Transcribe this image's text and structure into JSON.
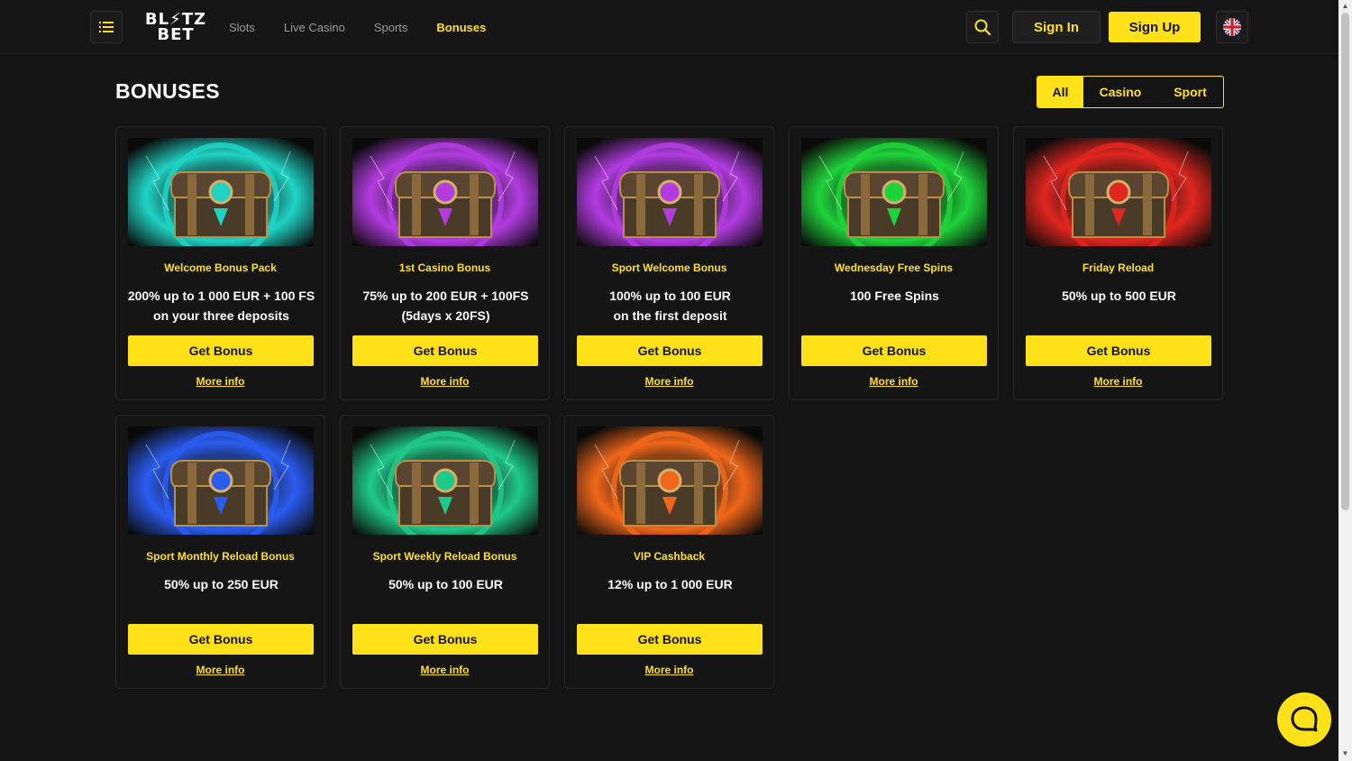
{
  "header": {
    "logo_line1": "BL⚡TZ",
    "logo_line2": "BET",
    "nav": [
      "Slots",
      "Live Casino",
      "Sports",
      "Bonuses"
    ],
    "active_nav": "Bonuses",
    "signin_label": "Sign In",
    "signup_label": "Sign Up"
  },
  "page": {
    "title": "BONUSES",
    "filters": [
      "All",
      "Casino",
      "Sport"
    ],
    "active_filter": "All"
  },
  "bonuses": [
    {
      "title": "Welcome Bonus Pack",
      "desc": "200% up to 1 000 EUR + 100 FS\non your three deposits",
      "button": "Get Bonus",
      "link": "More info",
      "color": "#1fd3c4"
    },
    {
      "title": "1st Casino Bonus",
      "desc": "75% up to 200 EUR + 100FS\n(5days x 20FS)",
      "button": "Get Bonus",
      "link": "More info",
      "color": "#b23ce0"
    },
    {
      "title": "Sport Welcome Bonus",
      "desc": "100% up to 100 EUR\non the first deposit",
      "button": "Get Bonus",
      "link": "More info",
      "color": "#b23ce0"
    },
    {
      "title": "Wednesday Free Spins",
      "desc": "100 Free Spins",
      "button": "Get Bonus",
      "link": "More info",
      "color": "#1fd33a"
    },
    {
      "title": "Friday Reload",
      "desc": "50% up to 500 EUR",
      "button": "Get Bonus",
      "link": "More info",
      "color": "#e0261f"
    },
    {
      "title": "Sport Monthly Reload Bonus",
      "desc": "50% up to 250 EUR",
      "button": "Get Bonus",
      "link": "More info",
      "color": "#2a5cf0"
    },
    {
      "title": "Sport Weekly Reload Bonus",
      "desc": "50% up to 100 EUR",
      "button": "Get Bonus",
      "link": "More info",
      "color": "#1fc98a"
    },
    {
      "title": "VIP Cashback",
      "desc": "12% up to 1 000 EUR",
      "button": "Get Bonus",
      "link": "More info",
      "color": "#f0671a"
    }
  ],
  "colors": {
    "accent": "#ffe11a",
    "background": "#141414"
  }
}
